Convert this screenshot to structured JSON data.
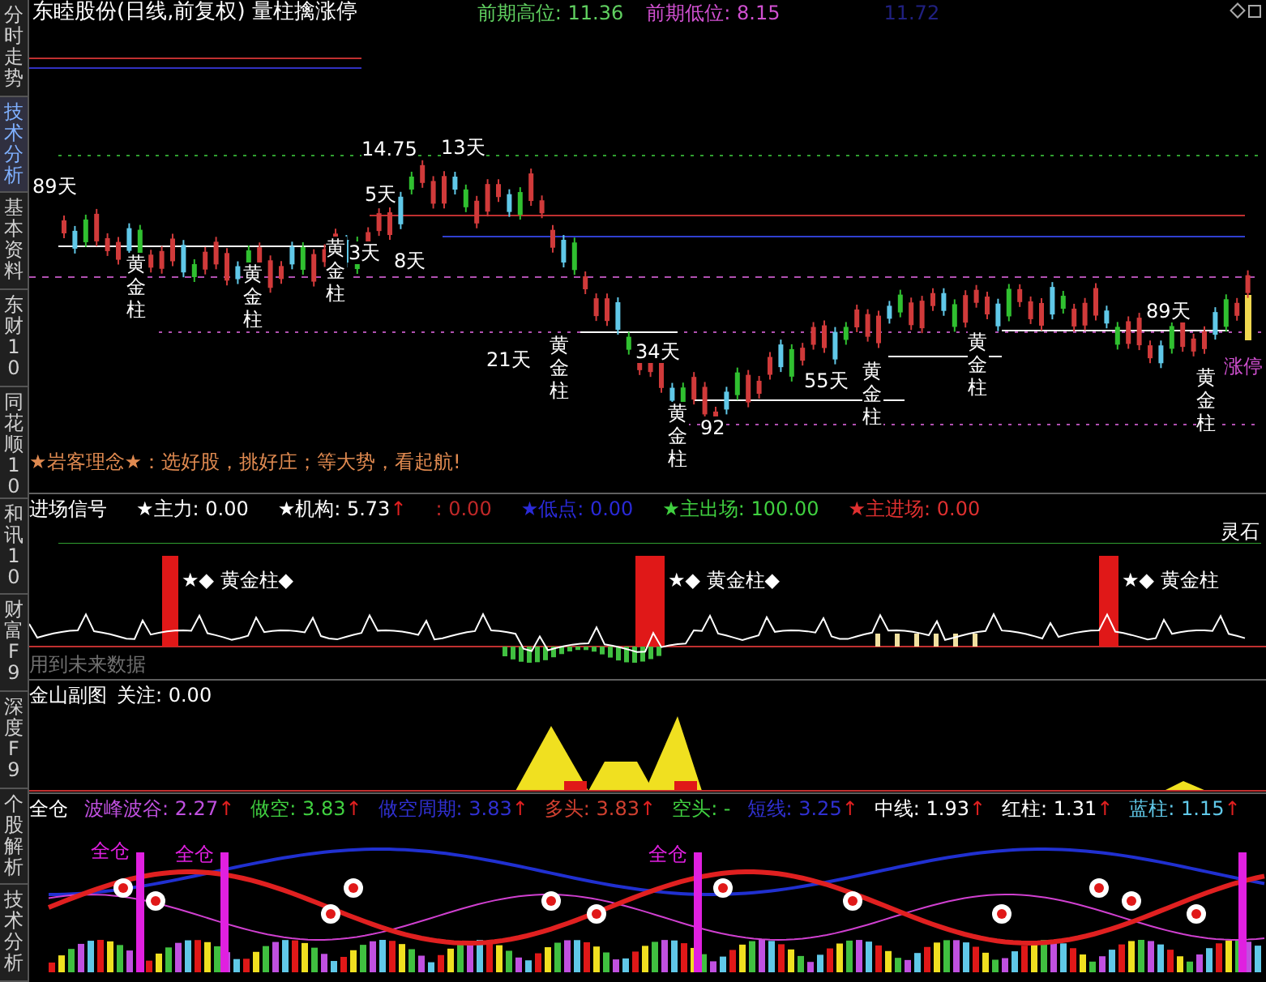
{
  "sidebar": {
    "tabs": [
      {
        "label": "分时走势",
        "selected": false
      },
      {
        "label": "技术分析",
        "selected": true
      },
      {
        "label": "基本资料",
        "selected": false
      },
      {
        "label": "东财10",
        "selected": false
      },
      {
        "label": "同花顺10",
        "selected": false
      },
      {
        "label": "和讯10",
        "selected": false
      },
      {
        "label": "财富F9",
        "selected": false
      },
      {
        "label": "深度F9",
        "selected": false
      },
      {
        "label": "个股解析",
        "selected": false
      },
      {
        "label": "技术分析",
        "selected": false
      }
    ]
  },
  "main_chart": {
    "title": "东睦股份(日线,前复权) 量柱擒涨停",
    "prior_high": "前期高位: 11.36",
    "prior_low": "前期低位: 8.15",
    "cursor_price": "11.72",
    "markers": [
      "89天",
      "14.75",
      "13天",
      "5天",
      "3天",
      "8天",
      "21天",
      "34天",
      "55天",
      "89天",
      "92"
    ],
    "pillars": [
      "黄金柱",
      "黄金柱",
      "黄金柱",
      "黄金柱",
      "黄金柱",
      "黄金柱",
      "黄金柱",
      "黄金柱"
    ],
    "limit_up": "涨停",
    "motto": "★岩客理念★：选好股，挑好庄；等大势，看起航!"
  },
  "entry_panel": {
    "title": "进场信号",
    "readings": [
      {
        "text": "★主力: 0.00",
        "color": "#ffffff"
      },
      {
        "text": "★机构: 5.73",
        "color": "#ffffff",
        "arrow": "↑"
      },
      {
        "text": ": 0.00",
        "color": "#c02828"
      },
      {
        "text": "★低点: 0.00",
        "color": "#2a2ad8"
      },
      {
        "text": "★主出场: 100.00",
        "color": "#40d040"
      },
      {
        "text": "★主进场: 0.00",
        "color": "#e03030"
      }
    ],
    "corner": "灵石",
    "pillar_labels": [
      "★◆ 黄金柱◆",
      "★◆ 黄金柱◆",
      "★◆ 黄金柱"
    ],
    "note": "用到未来数据"
  },
  "gold_panel": {
    "title": "金山副图",
    "readings": [
      {
        "text": "关注: 0.00",
        "color": "#ffffff"
      }
    ]
  },
  "tech_panel": {
    "readings": [
      {
        "text": "全仓",
        "color": "#ffffff"
      },
      {
        "text": "波峰波谷: 2.27",
        "color": "#c050e0",
        "arrow": "↑"
      },
      {
        "text": "做空: 3.83",
        "color": "#40d040",
        "arrow": "↑"
      },
      {
        "text": "做空周期: 3.83",
        "color": "#3030d0",
        "arrow": "↑"
      },
      {
        "text": "多头: 3.83",
        "color": "#d04030",
        "arrow": "↑"
      },
      {
        "text": "空头: -",
        "color": "#40d040"
      },
      {
        "text": "短线: 3.25",
        "color": "#3030d0",
        "arrow": "↑"
      },
      {
        "text": "中线: 1.93",
        "color": "#ffffff",
        "arrow": "↑"
      },
      {
        "text": "红柱: 1.31",
        "color": "#ffffff",
        "arrow": "↑"
      },
      {
        "text": "蓝柱: 1.15",
        "color": "#60c8e8",
        "arrow": "↑"
      }
    ],
    "full_position_labels": [
      "全仓",
      "全仓",
      "全仓"
    ]
  }
}
